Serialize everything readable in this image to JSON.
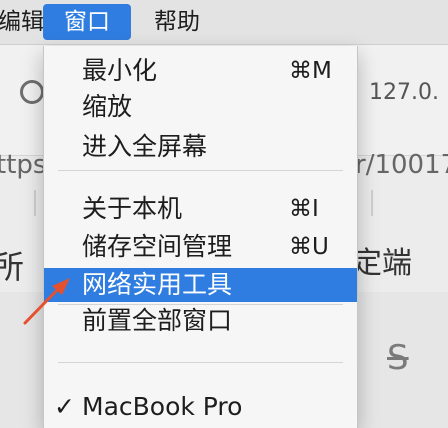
{
  "menubar": {
    "edit_label": "编辑",
    "window_label": "窗口",
    "help_label": "帮助"
  },
  "background": {
    "ip_text": "127.0.",
    "url_left": "ttps",
    "url_right": "r/10017",
    "chinese_left": "所",
    "chinese_right": "定端",
    "strike_symbol": "S"
  },
  "menu": {
    "items": [
      {
        "label": "最小化",
        "shortcut": "⌘M"
      },
      {
        "label": "缩放",
        "shortcut": ""
      },
      {
        "label": "进入全屏幕",
        "shortcut": ""
      },
      {
        "label": "关于本机",
        "shortcut": "⌘I"
      },
      {
        "label": "储存空间管理",
        "shortcut": "⌘U"
      },
      {
        "label": "网络实用工具",
        "shortcut": ""
      },
      {
        "label": "前置全部窗口",
        "shortcut": ""
      },
      {
        "label": "MacBook Pro",
        "shortcut": "",
        "checked": "✓"
      }
    ]
  },
  "colors": {
    "accent": "#2f7de0",
    "annotation_arrow": "#e5512e"
  }
}
